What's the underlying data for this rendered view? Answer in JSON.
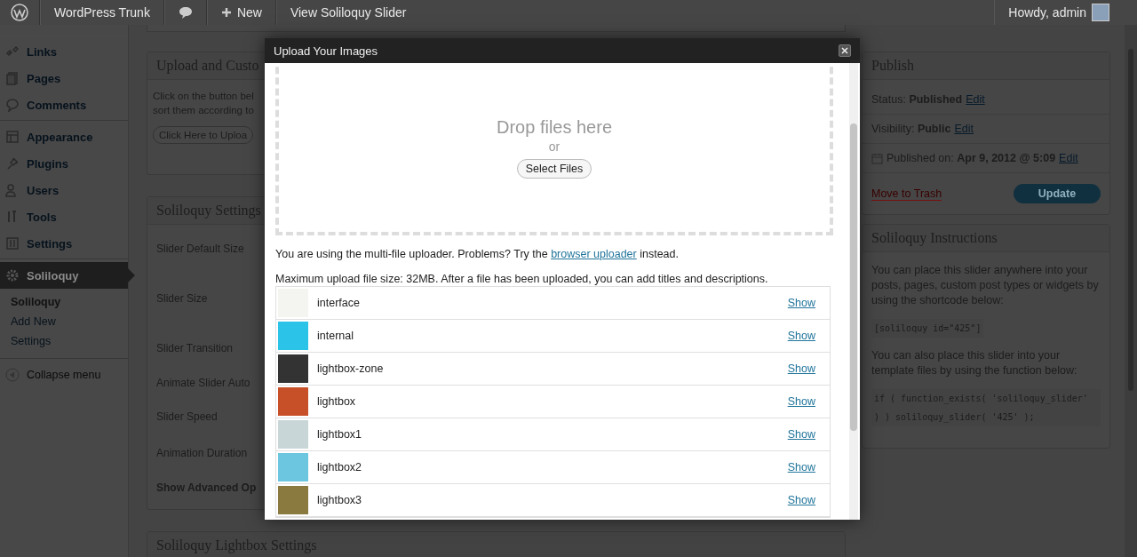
{
  "admin_bar": {
    "site_name": "WordPress Trunk",
    "new_label": "New",
    "view_link": "View Soliloquy Slider",
    "greeting": "Howdy, admin"
  },
  "sidebar": {
    "groups": [
      {
        "items": [
          {
            "label": "Links",
            "selected": false
          },
          {
            "label": "Pages",
            "selected": false
          },
          {
            "label": "Comments",
            "selected": false
          }
        ]
      },
      {
        "items": [
          {
            "label": "Appearance",
            "selected": false
          },
          {
            "label": "Plugins",
            "selected": false
          },
          {
            "label": "Users",
            "selected": false
          },
          {
            "label": "Tools",
            "selected": false
          },
          {
            "label": "Settings",
            "selected": false
          }
        ]
      },
      {
        "items": [
          {
            "label": "Soliloquy",
            "selected": true,
            "children": [
              {
                "label": "Soliloquy",
                "selected": true
              },
              {
                "label": "Add New",
                "selected": false
              },
              {
                "label": "Settings",
                "selected": false
              }
            ]
          }
        ]
      }
    ],
    "collapse": "Collapse menu"
  },
  "main": {
    "panels": [
      {
        "kind": "upload",
        "title": "Upload and Custo",
        "lines": [
          "Click on the button bel",
          "sort them according to"
        ],
        "button": "Click Here to Uploa"
      },
      {
        "kind": "settings",
        "title": "Soliloquy Settings",
        "fields": [
          {
            "label": "Slider Default Size",
            "bold": false
          },
          {
            "label": "Slider Size",
            "bold": false
          },
          {
            "label": "Slider Transition",
            "bold": false
          },
          {
            "label": "Animate Slider Auto",
            "bold": false
          },
          {
            "label": "Slider Speed",
            "bold": false
          },
          {
            "label": "Animation Duration",
            "bold": false
          },
          {
            "label": "Show Advanced Op",
            "bold": true
          }
        ]
      },
      {
        "kind": "collapsed",
        "title": "Soliloquy Lightbox Settings"
      }
    ]
  },
  "publish": {
    "title": "Publish",
    "status": "Status: **Published**",
    "visibility": "Visibility: **Public**",
    "published_on": "Published on: **Apr 9, 2012 @ 5:09**",
    "edit_links": [
      "Edit",
      "Edit",
      "Edit"
    ],
    "trash": "Move to Trash",
    "update": "Update"
  },
  "instructions": {
    "title": "Soliloquy Instructions",
    "text_1": "You can place this slider anywhere into your posts, pages, custom post types or widgets by using the shortcode below:",
    "code_1": "[soliloquy id=\"425\"]",
    "text_2": "You can also place this slider into your template files by using the function below:",
    "code_2": "if ( function_exists( 'soliloquy_slider' ) ) soliloquy_slider( '425' );"
  },
  "modal": {
    "title": "Upload Your Images",
    "drop_title": "Drop files here",
    "or": "or",
    "select_button": "Select Files",
    "note": "You are using the multi-file uploader. Problems? Try the",
    "note_link": "browser uploader",
    "note_end": "instead.",
    "max_size": "Maximum upload file size: 32MB. After a file has been uploaded, you can add titles and descriptions.",
    "files": [
      {
        "name": "interface",
        "action": "Show"
      },
      {
        "name": "internal",
        "action": "Show"
      },
      {
        "name": "lightbox-zone",
        "action": "Show"
      },
      {
        "name": "lightbox",
        "action": "Show"
      },
      {
        "name": "lightbox1",
        "action": "Show"
      },
      {
        "name": "lightbox2",
        "action": "Show"
      },
      {
        "name": "lightbox3",
        "action": "Show"
      }
    ]
  }
}
